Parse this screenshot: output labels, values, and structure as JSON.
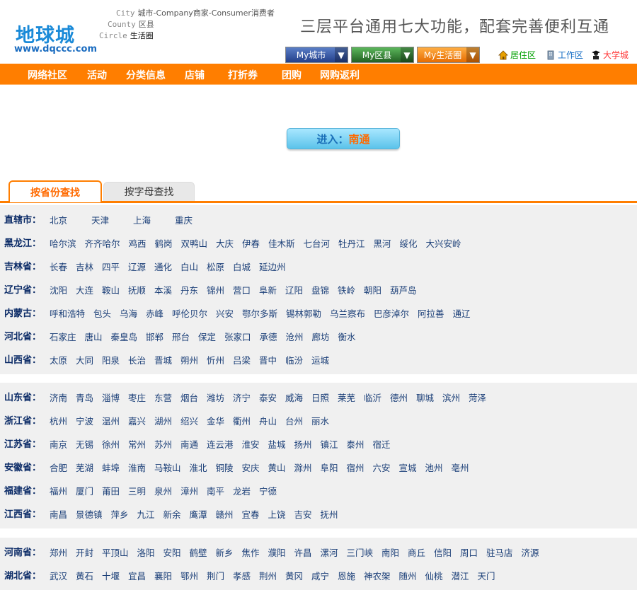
{
  "header": {
    "logo_text": "地球城",
    "logo_url": "www.dqccc.com",
    "legend": [
      {
        "label": "City",
        "value": "城市-Company商家-Consumer消费者"
      },
      {
        "label": "County",
        "value": "区县"
      },
      {
        "label": "Circle",
        "value": "生活圈"
      }
    ],
    "slogan": "三层平台通用七大功能，配套完善便利互通",
    "dropdowns": [
      {
        "label": "My城市",
        "arrow": "▼"
      },
      {
        "label": "My区县",
        "arrow": "▼"
      },
      {
        "label": "My生活圈",
        "arrow": "▼"
      }
    ],
    "zones": [
      {
        "label": "居住区",
        "color": "#00a000"
      },
      {
        "label": "工作区",
        "color": "#0a66c2"
      },
      {
        "label": "大学城",
        "color": "#ff3333"
      }
    ]
  },
  "nav": [
    "网络社区",
    "活动",
    "分类信息",
    "店铺",
    "打折券",
    "团购",
    "网购返利"
  ],
  "enter": {
    "prefix": "进入：",
    "city": "南通"
  },
  "tabs": [
    "按省份查找",
    "按字母查找"
  ],
  "colors": {
    "accent": "#ff7e00",
    "link": "#1b3f78",
    "province": "#0a2a66"
  },
  "groups": [
    [
      {
        "province": "直辖市：",
        "cities": [
          "北京",
          "天津",
          "上海",
          "重庆"
        ]
      },
      {
        "province": "黑龙江：",
        "cities": [
          "哈尔滨",
          "齐齐哈尔",
          "鸡西",
          "鹤岗",
          "双鸭山",
          "大庆",
          "伊春",
          "佳木斯",
          "七台河",
          "牡丹江",
          "黑河",
          "绥化",
          "大兴安岭"
        ]
      },
      {
        "province": "吉林省：",
        "cities": [
          "长春",
          "吉林",
          "四平",
          "辽源",
          "通化",
          "白山",
          "松原",
          "白城",
          "延边州"
        ]
      },
      {
        "province": "辽宁省：",
        "cities": [
          "沈阳",
          "大连",
          "鞍山",
          "抚顺",
          "本溪",
          "丹东",
          "锦州",
          "营口",
          "阜新",
          "辽阳",
          "盘锦",
          "铁岭",
          "朝阳",
          "葫芦岛"
        ]
      },
      {
        "province": "内蒙古：",
        "cities": [
          "呼和浩特",
          "包头",
          "乌海",
          "赤峰",
          "呼伦贝尔",
          "兴安",
          "鄂尔多斯",
          "锡林郭勒",
          "乌兰察布",
          "巴彦淖尔",
          "阿拉善",
          "通辽"
        ]
      },
      {
        "province": "河北省：",
        "cities": [
          "石家庄",
          "唐山",
          "秦皇岛",
          "邯郸",
          "邢台",
          "保定",
          "张家口",
          "承德",
          "沧州",
          "廊坊",
          "衡水"
        ]
      },
      {
        "province": "山西省：",
        "cities": [
          "太原",
          "大同",
          "阳泉",
          "长治",
          "晋城",
          "朔州",
          "忻州",
          "吕梁",
          "晋中",
          "临汾",
          "运城"
        ]
      }
    ],
    [
      {
        "province": "山东省：",
        "cities": [
          "济南",
          "青岛",
          "淄博",
          "枣庄",
          "东营",
          "烟台",
          "潍坊",
          "济宁",
          "泰安",
          "威海",
          "日照",
          "莱芜",
          "临沂",
          "德州",
          "聊城",
          "滨州",
          "菏泽"
        ]
      },
      {
        "province": "浙江省：",
        "cities": [
          "杭州",
          "宁波",
          "温州",
          "嘉兴",
          "湖州",
          "绍兴",
          "金华",
          "衢州",
          "舟山",
          "台州",
          "丽水"
        ]
      },
      {
        "province": "江苏省：",
        "cities": [
          "南京",
          "无锡",
          "徐州",
          "常州",
          "苏州",
          "南通",
          "连云港",
          "淮安",
          "盐城",
          "扬州",
          "镇江",
          "泰州",
          "宿迁"
        ]
      },
      {
        "province": "安徽省：",
        "cities": [
          "合肥",
          "芜湖",
          "蚌埠",
          "淮南",
          "马鞍山",
          "淮北",
          "铜陵",
          "安庆",
          "黄山",
          "滁州",
          "阜阳",
          "宿州",
          "六安",
          "宣城",
          "池州",
          "亳州"
        ]
      },
      {
        "province": "福建省：",
        "cities": [
          "福州",
          "厦门",
          "莆田",
          "三明",
          "泉州",
          "漳州",
          "南平",
          "龙岩",
          "宁德"
        ]
      },
      {
        "province": "江西省：",
        "cities": [
          "南昌",
          "景德镇",
          "萍乡",
          "九江",
          "新余",
          "鹰潭",
          "赣州",
          "宜春",
          "上饶",
          "吉安",
          "抚州"
        ]
      }
    ],
    [
      {
        "province": "河南省：",
        "cities": [
          "郑州",
          "开封",
          "平顶山",
          "洛阳",
          "安阳",
          "鹤壁",
          "新乡",
          "焦作",
          "濮阳",
          "许昌",
          "漯河",
          "三门峡",
          "南阳",
          "商丘",
          "信阳",
          "周口",
          "驻马店",
          "济源"
        ]
      },
      {
        "province": "湖北省：",
        "cities": [
          "武汉",
          "黄石",
          "十堰",
          "宜昌",
          "襄阳",
          "鄂州",
          "荆门",
          "孝感",
          "荆州",
          "黄冈",
          "咸宁",
          "恩施",
          "神农架",
          "随州",
          "仙桃",
          "潜江",
          "天门"
        ]
      }
    ]
  ]
}
